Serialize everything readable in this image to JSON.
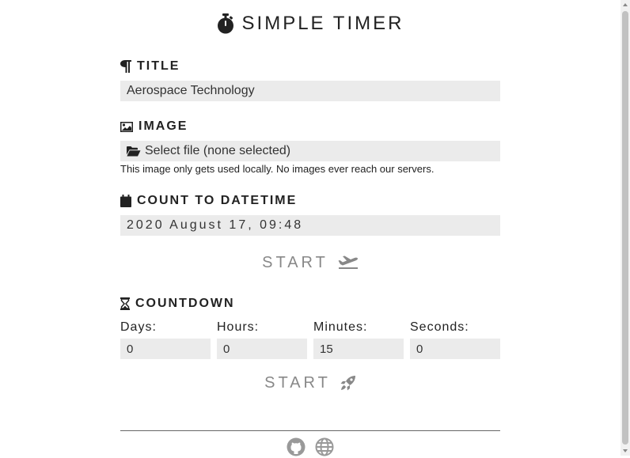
{
  "header": {
    "app_title": "SIMPLE TIMER",
    "icon": "stopwatch-icon"
  },
  "title_section": {
    "label": "TITLE",
    "icon": "paragraph-icon",
    "value": "Aerospace Technology"
  },
  "image_section": {
    "label": "IMAGE",
    "icon": "image-icon",
    "file_button_label": "Select file (none selected)",
    "file_icon": "folder-open-icon",
    "hint": "This image only gets used locally. No images ever reach our servers."
  },
  "datetime_section": {
    "label": "COUNT TO DATETIME",
    "icon": "calendar-icon",
    "value": "2020 August 17, 09:48",
    "start_label": "START",
    "start_icon": "plane-departure-icon"
  },
  "countdown_section": {
    "label": "COUNTDOWN",
    "icon": "hourglass-icon",
    "fields": [
      {
        "label": "Days:",
        "value": "0"
      },
      {
        "label": "Hours:",
        "value": "0"
      },
      {
        "label": "Minutes:",
        "value": "15"
      },
      {
        "label": "Seconds:",
        "value": "0"
      }
    ],
    "start_label": "START",
    "start_icon": "rocket-icon"
  },
  "footer": {
    "icons": [
      "github-icon",
      "globe-icon"
    ]
  },
  "colors": {
    "text": "#222222",
    "field_bg": "#ebebeb",
    "start_text": "#888888",
    "footer_icon": "#999999"
  }
}
